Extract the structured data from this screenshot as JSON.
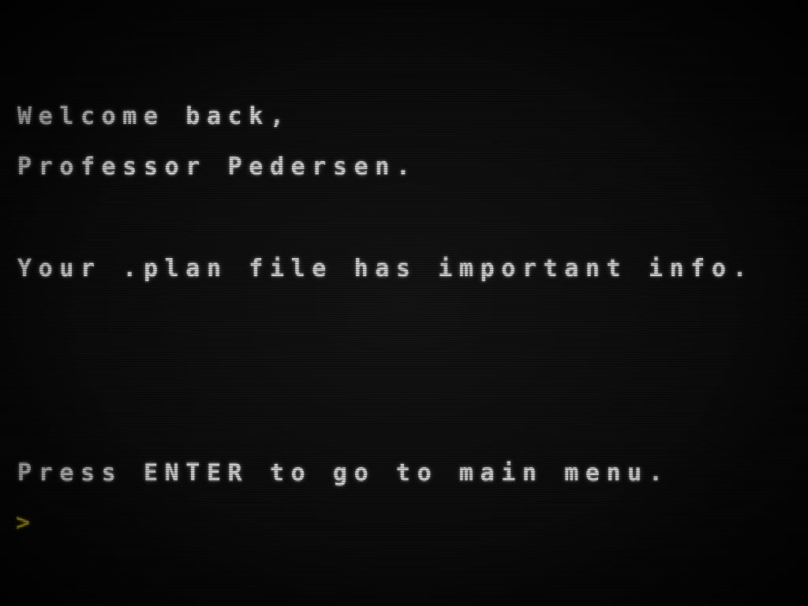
{
  "terminal": {
    "lines": [
      "Welcome back,",
      "Professor Pedersen.",
      "Your .plan file has important info.",
      "Press ENTER to go to main menu."
    ],
    "prompt_symbol": ">",
    "input_value": "",
    "colors": {
      "text": "#d2d2d2",
      "prompt": "#b9a900",
      "background": "#0e0e0e"
    }
  }
}
